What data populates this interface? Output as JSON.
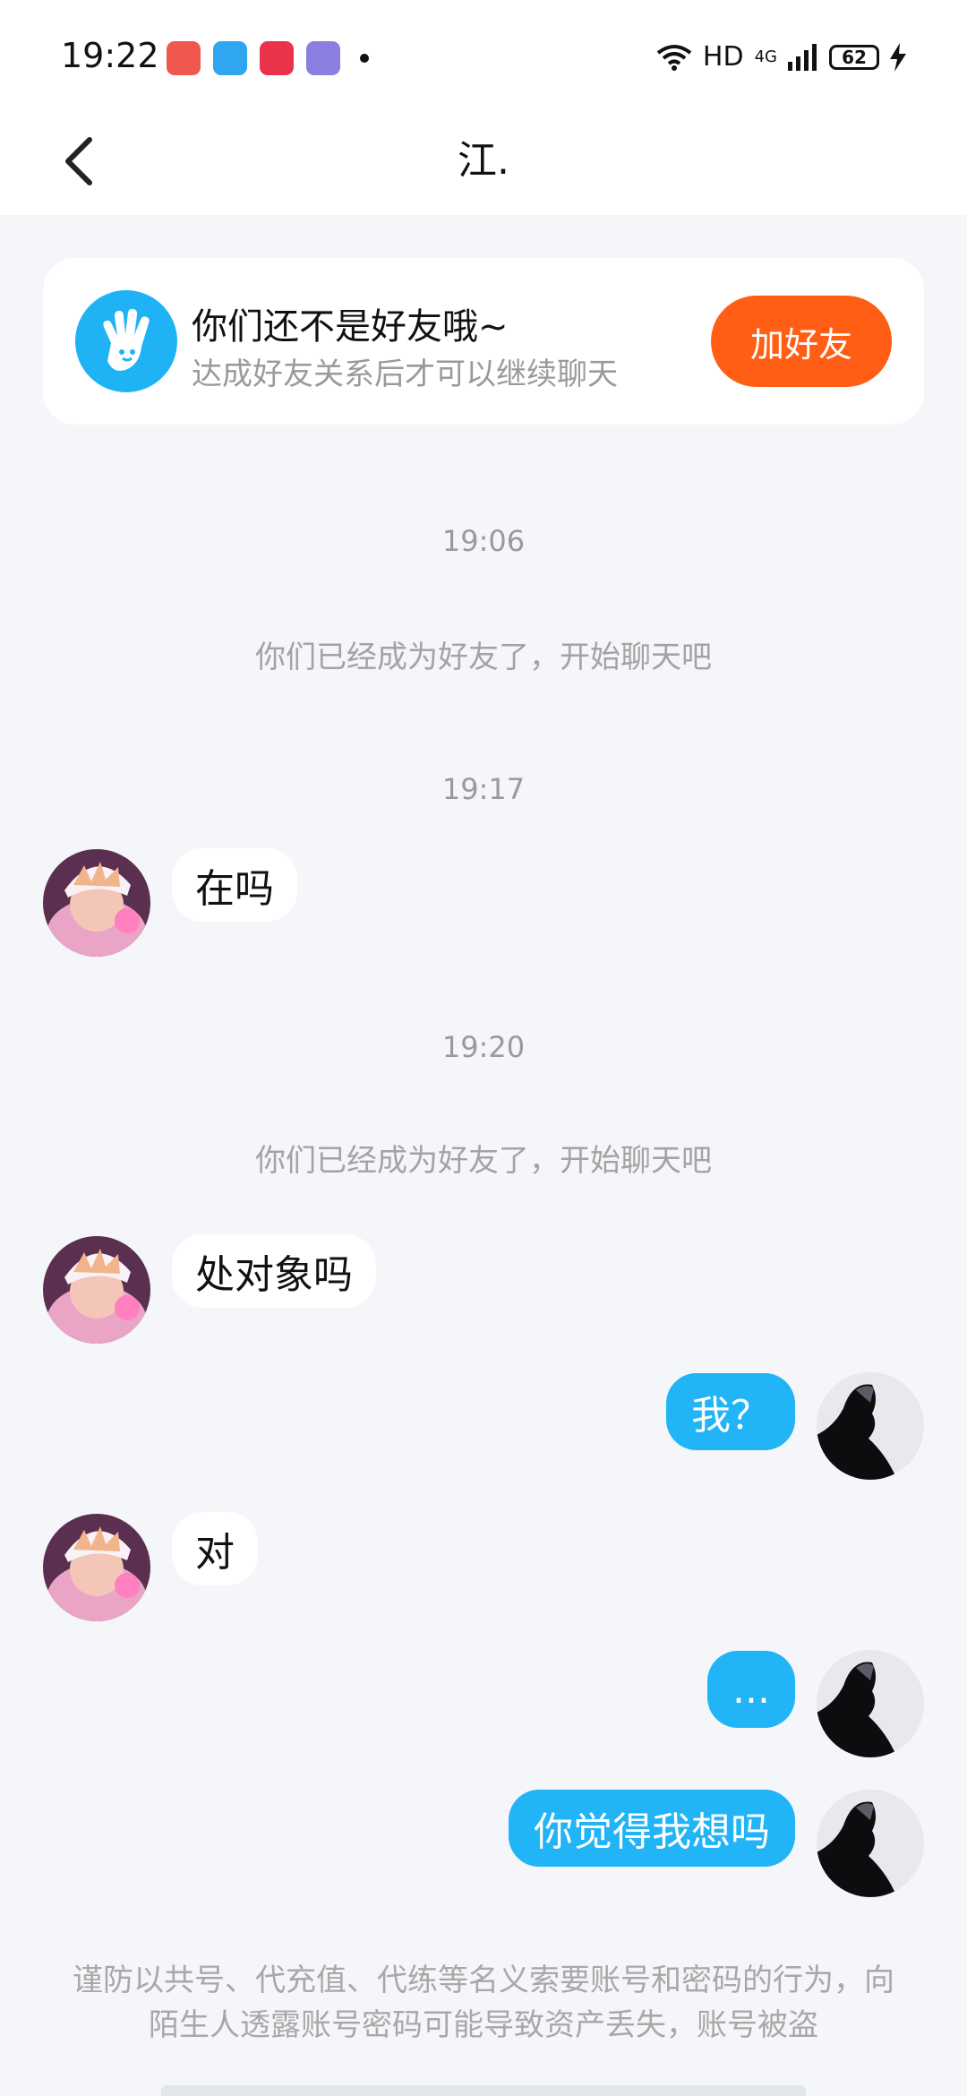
{
  "status": {
    "time": "19:22",
    "network": "HD",
    "signal": "4G",
    "battery": "62"
  },
  "header": {
    "title": "江."
  },
  "friend_card": {
    "title": "你们还不是好友哦~",
    "subtitle": "达成好友关系后才可以继续聊天",
    "button": "加好友"
  },
  "messages": {
    "ts1": "19:06",
    "sys1": "你们已经成为好友了，开始聊天吧",
    "ts2": "19:17",
    "in1": "在吗",
    "ts3": "19:20",
    "sys2": "你们已经成为好友了，开始聊天吧",
    "in2": "处对象吗",
    "out1": "我？",
    "in3": "对",
    "out2": "...",
    "out3": "你觉得我想吗"
  },
  "footer": {
    "warning": "谨防以共号、代充值、代练等名义索要账号和密码的行为，向陌生人透露账号密码可能导致资产丢失，账号被盗"
  },
  "colors": {
    "accent_blue": "#21b4f6",
    "add_button": "#ff5e14",
    "background": "#f4f6f9"
  }
}
